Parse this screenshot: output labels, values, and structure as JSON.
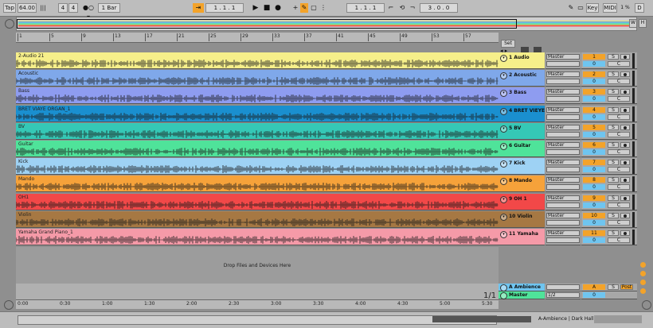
{
  "transport": {
    "tap": "Tap",
    "tempo": "64.00",
    "sig_num": "4",
    "sig_den": "4",
    "quantize": "1 Bar",
    "position": "1 .   1 .   1",
    "loop_start": "1 .   1 .   1",
    "loop_len": "3 .   0 .   0",
    "key": "Key",
    "midi": "MIDI",
    "cpu": "1 %",
    "d": "D"
  },
  "ruler_bars": [
    "1",
    "5",
    "9",
    "13",
    "17",
    "21",
    "25",
    "29",
    "33",
    "37",
    "41",
    "45",
    "49",
    "53",
    "57"
  ],
  "set_label": "Set",
  "tracks": [
    {
      "clip_name": "2-Audio 21",
      "label": "1 Audio",
      "color": "#f6ef8a",
      "col": "#f6ef8a",
      "num": "1",
      "out": "Master"
    },
    {
      "clip_name": "Acoustic",
      "label": "2 Acoustic",
      "color": "#7fa8ea",
      "col": "#7fa8ea",
      "num": "2",
      "out": "Master"
    },
    {
      "clip_name": "Bass",
      "label": "3 Bass",
      "color": "#8e9cf0",
      "col": "#8e9cf0",
      "num": "3",
      "out": "Master"
    },
    {
      "clip_name": "BRET VIAYE ORGAN_1",
      "label": "4 BRET VIEYE",
      "color": "#1a8fcf",
      "col": "#1a8fcf",
      "num": "4",
      "out": "Master"
    },
    {
      "clip_name": "BV",
      "label": "5 BV",
      "color": "#35c8b6",
      "col": "#35c8b6",
      "num": "5",
      "out": "Master"
    },
    {
      "clip_name": "Guitar",
      "label": "6 Guitar",
      "color": "#4fe39a",
      "col": "#4fe39a",
      "num": "6",
      "out": "Master"
    },
    {
      "clip_name": "Kick",
      "label": "7 Kick",
      "color": "#9ed2f4",
      "col": "#9ed2f4",
      "num": "7",
      "out": "Master"
    },
    {
      "clip_name": "Mando",
      "label": "8 Mando",
      "color": "#f6a23a",
      "col": "#f6a23a",
      "num": "8",
      "out": "Master"
    },
    {
      "clip_name": "OH1",
      "label": "9 OH 1",
      "color": "#f24848",
      "col": "#f24848",
      "num": "9",
      "out": "Master"
    },
    {
      "clip_name": "Violin",
      "label": "10 Violin",
      "color": "#a67843",
      "col": "#a67843",
      "num": "10",
      "out": "Master"
    },
    {
      "clip_name": "Yamaha Grand Piano_1",
      "label": "11 Yamaha",
      "color": "#f59aa8",
      "col": "#f59aa8",
      "num": "11",
      "out": "Master"
    }
  ],
  "drop_text": "Drop Files and Devices Here",
  "returns": [
    {
      "label": "A Ambience",
      "num": "A",
      "post": "Post"
    },
    {
      "label": "Master",
      "out": "1/2",
      "num": "0"
    }
  ],
  "zero": "0",
  "s_label": "S",
  "c_label": "C",
  "page_marker": "1/1",
  "time_marks": [
    "0:00",
    "0:30",
    "1:00",
    "1:30",
    "2:00",
    "2:30",
    "3:00",
    "3:30",
    "4:00",
    "4:30",
    "5:00",
    "5:30"
  ],
  "status_text": "A-Ambience | Dark Hall",
  "hw": [
    "H",
    "W"
  ]
}
